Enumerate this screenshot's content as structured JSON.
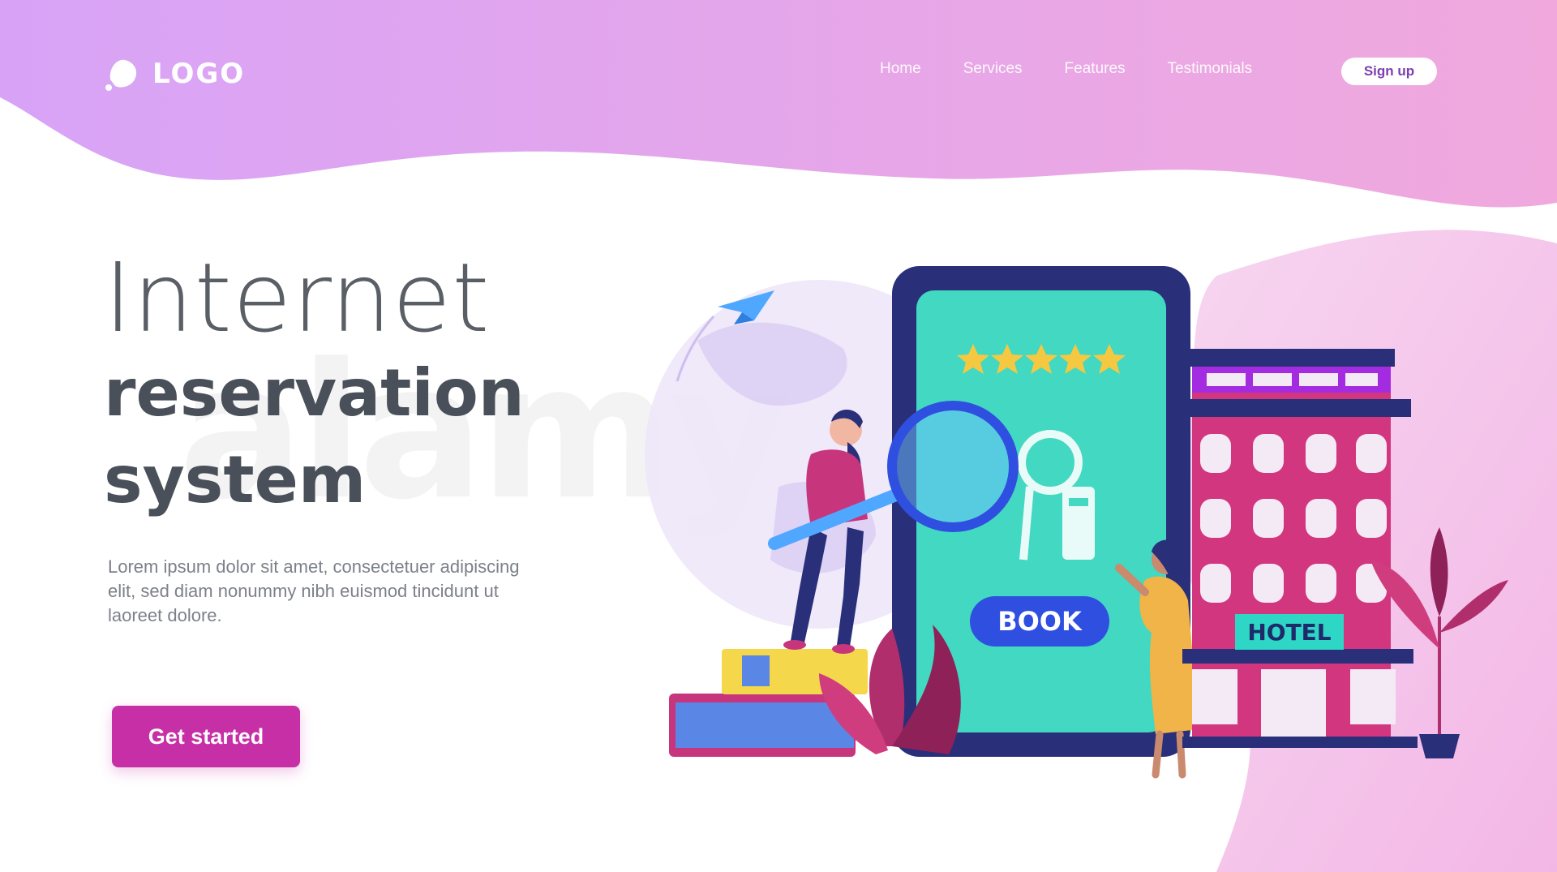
{
  "header": {
    "logo_text": "LOGO",
    "nav": [
      "Home",
      "Services",
      "Features",
      "Testimonials"
    ],
    "signup_label": "Sign up"
  },
  "hero": {
    "title_line1": "Internet",
    "title_line2": "reservation",
    "title_line3": "system",
    "description": "Lorem ipsum dolor sit amet, consectetuer adipiscing elit, sed diam nonummy nibh euismod tincidunt ut laoreet dolore.",
    "cta_label": "Get started"
  },
  "illustration": {
    "book_label": "BOOK",
    "hotel_label": "HOTEL",
    "rating_stars": 5
  },
  "colors": {
    "accent": "#c72fa6",
    "header_gradient_start": "#d6a4f5",
    "header_gradient_end": "#f2a5dd",
    "book_button": "#2f4fe0",
    "phone_screen": "#43d8c1"
  }
}
